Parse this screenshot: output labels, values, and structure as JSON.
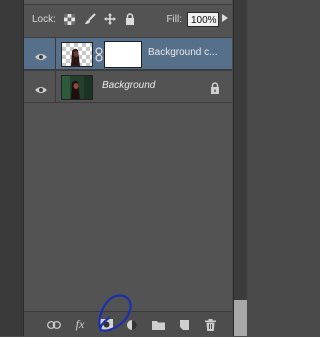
{
  "lock_bar": {
    "label": "Lock:",
    "fill_label": "Fill:",
    "fill_value": "100%"
  },
  "layers": [
    {
      "name": "Background c...",
      "selected": true,
      "locked": false
    },
    {
      "name": "Background",
      "selected": false,
      "locked": true
    }
  ],
  "bottom_bar": {
    "buttons": [
      "link-layers",
      "fx",
      "add-layer-mask",
      "adjustment-layer",
      "new-group",
      "new-layer",
      "delete-layer"
    ],
    "fx_label": "fx"
  },
  "colors": {
    "panel": "#535353",
    "selected_layer": "#566f8b",
    "annotation": "#1a2fb0"
  }
}
